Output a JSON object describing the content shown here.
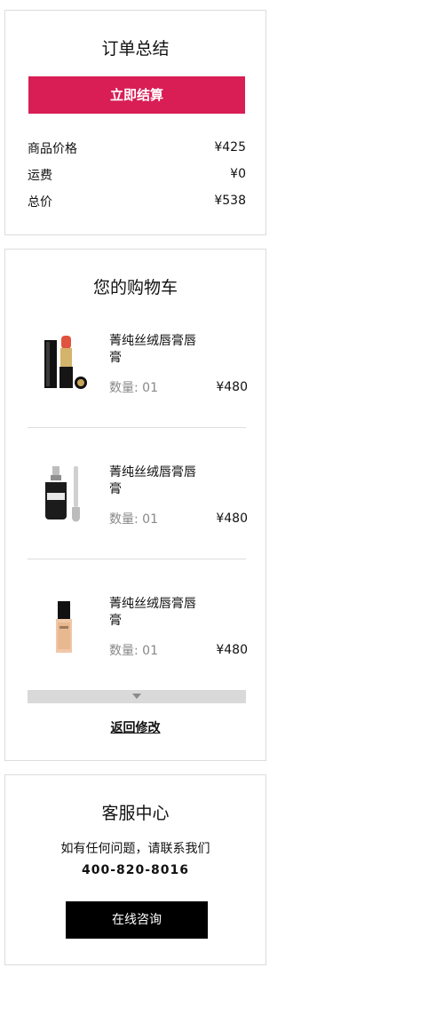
{
  "summary": {
    "title": "订单总结",
    "checkout_label": "立即结算",
    "rows": [
      {
        "label": "商品价格",
        "value": "¥425"
      },
      {
        "label": "运费",
        "value": "¥0"
      },
      {
        "label": "总价",
        "value": "¥538"
      }
    ]
  },
  "cart": {
    "title": "您的购物车",
    "items": [
      {
        "name": "菁纯丝绒唇膏唇膏",
        "qty": "数量: 01",
        "price": "¥480",
        "image_icon": "lipstick-icon"
      },
      {
        "name": "菁纯丝绒唇膏唇膏",
        "qty": "数量: 01",
        "price": "¥480",
        "image_icon": "serum-bottle-icon"
      },
      {
        "name": "菁纯丝绒唇膏唇膏",
        "qty": "数量: 01",
        "price": "¥480",
        "image_icon": "foundation-bottle-icon"
      }
    ],
    "back_label": "返回修改"
  },
  "service": {
    "title": "客服中心",
    "text": "如有任何问题，请联系我们",
    "phone": "400-820-8016",
    "consult_label": "在线咨询"
  },
  "colors": {
    "accent": "#d81e55",
    "border": "#dcdcdc",
    "dark_button": "#000000"
  }
}
